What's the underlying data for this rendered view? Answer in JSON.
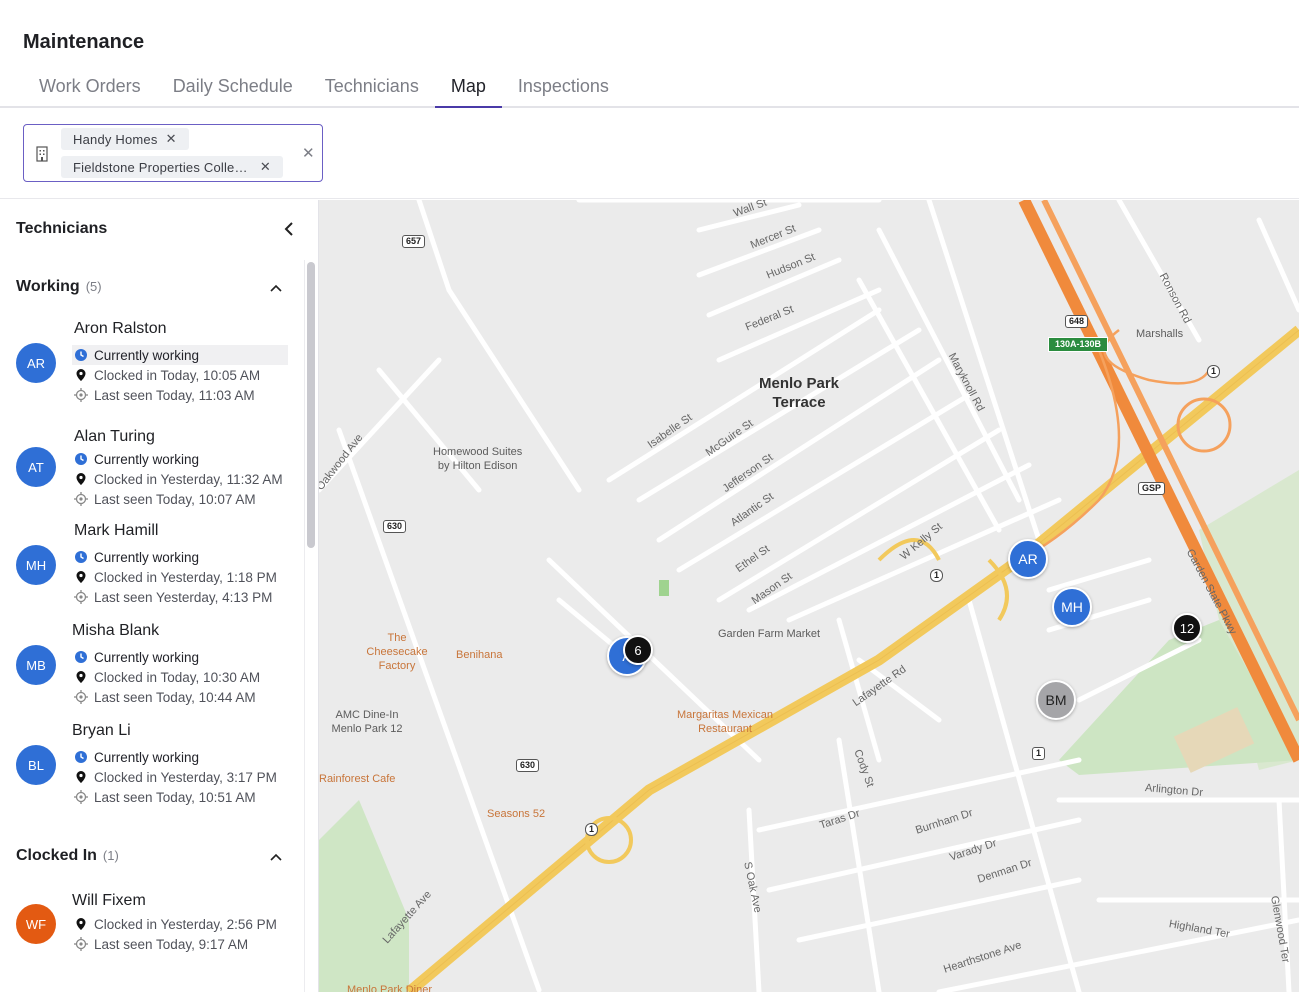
{
  "header": {
    "title": "Maintenance"
  },
  "tabs": [
    {
      "label": "Work Orders",
      "active": false
    },
    {
      "label": "Daily Schedule",
      "active": false
    },
    {
      "label": "Technicians",
      "active": false
    },
    {
      "label": "Map",
      "active": true
    },
    {
      "label": "Inspections",
      "active": false
    }
  ],
  "filter": {
    "icon": "building-icon",
    "chips": [
      "Handy Homes",
      "Fieldstone Properties Collec…"
    ],
    "clear_icon": "close-icon"
  },
  "sidebar": {
    "title": "Technicians",
    "sections": {
      "working": {
        "label": "Working",
        "count": "(5)"
      },
      "clocked_in": {
        "label": "Clocked In",
        "count": "(1)"
      }
    },
    "technicians": [
      {
        "initials": "AR",
        "name": "Aron Ralston",
        "status": "Currently working",
        "clocked": "Clocked in Today, 10:05 AM",
        "seen": "Last seen Today, 11:03 AM",
        "color": "#2f6fd6"
      },
      {
        "initials": "AT",
        "name": "Alan Turing",
        "status": "Currently working",
        "clocked": "Clocked in Yesterday, 11:32 AM",
        "seen": "Last seen Today, 10:07 AM",
        "color": "#2f6fd6"
      },
      {
        "initials": "MH",
        "name": "Mark Hamill",
        "status": "Currently working",
        "clocked": "Clocked in Yesterday, 1:18 PM",
        "seen": "Last seen Yesterday, 4:13 PM",
        "color": "#2f6fd6"
      },
      {
        "initials": "MB",
        "name": "Misha Blank",
        "status": "Currently working",
        "clocked": "Clocked in Today, 10:30 AM",
        "seen": "Last seen Today, 10:44 AM",
        "color": "#2f6fd6"
      },
      {
        "initials": "BL",
        "name": "Bryan Li",
        "status": "Currently working",
        "clocked": "Clocked in Yesterday, 3:17 PM",
        "seen": "Last seen Today, 10:51 AM",
        "color": "#2f6fd6"
      }
    ],
    "clocked_in_technicians": [
      {
        "initials": "WF",
        "name": "Will Fixem",
        "clocked": "Clocked in Yesterday, 2:56 PM",
        "seen": "Last seen Today, 9:17 AM",
        "color": "#e35a12"
      }
    ]
  },
  "map": {
    "neighborhood": "Menlo Park\nTerrace",
    "pins": [
      {
        "label": "AR",
        "style": "blue"
      },
      {
        "label": "MH",
        "style": "blue"
      },
      {
        "label": "BM",
        "style": "grey"
      },
      {
        "label": "A",
        "style": "blue"
      },
      {
        "label": "6",
        "style": "black"
      },
      {
        "label": "12",
        "style": "black"
      }
    ],
    "streets": [
      "Wall St",
      "Mercer St",
      "Hudson St",
      "Federal St",
      "Isabelle St",
      "McGuire St",
      "Jefferson St",
      "Atlantic St",
      "Ethel St",
      "Mason St",
      "W Kelly St",
      "Lafayette Rd",
      "Cody St",
      "Oakwood Ave",
      "Maryknoll Rd",
      "Ronson Rd",
      "Garden State Pkwy",
      "Arlington Dr",
      "Burnham Dr",
      "Taras Dr",
      "Varady Dr",
      "Denman Dr",
      "S Oak Ave",
      "Highland Ter",
      "Hearthstone Ave",
      "Glenwood Ter",
      "Lafayette Ave"
    ],
    "pois": [
      "Homewood Suites\nby Hilton Edison",
      "Marshalls",
      "The Cheesecake\nFactory",
      "Benihana",
      "Garden Farm Market",
      "Margaritas Mexican\nRestaurant",
      "AMC Dine-In\nMenlo Park 12",
      "Rainforest Cafe",
      "Seasons 52",
      "Menlo Park Diner"
    ],
    "shields": [
      "657",
      "630",
      "630",
      "1",
      "1",
      "1",
      "1",
      "648",
      "GSP",
      "GSP",
      "130A-130B"
    ]
  }
}
